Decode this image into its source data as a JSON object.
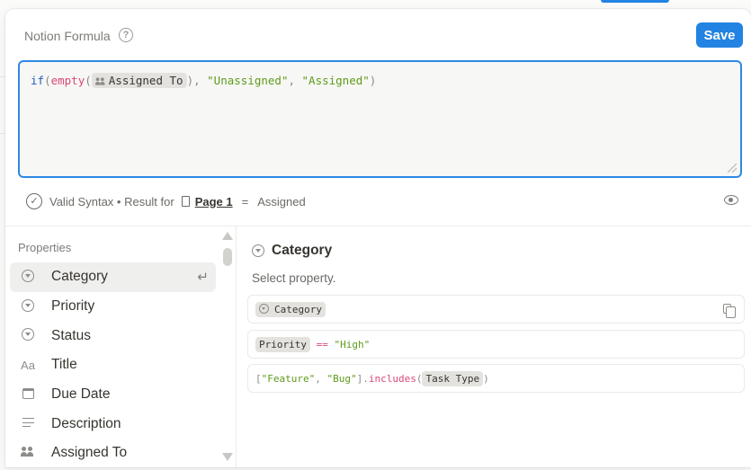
{
  "header": {
    "title": "Notion Formula",
    "help_glyph": "?",
    "save_label": "Save"
  },
  "editor": {
    "keyword_if": "if",
    "open_paren": "(",
    "fn_empty": "empty",
    "fn_open": "(",
    "chip_label": "Assigned To",
    "fn_close": ")",
    "sep": ", ",
    "str_unassigned": "\"Unassigned\"",
    "str_assigned": "\"Assigned\"",
    "close_paren": ")"
  },
  "status": {
    "check_glyph": "✓",
    "text_prefix": "Valid Syntax • Result for",
    "page_name": "Page 1",
    "equals": "=",
    "result_value": "Assigned"
  },
  "properties": {
    "header": "Properties",
    "items": [
      {
        "label": "Category",
        "icon": "select-icon"
      },
      {
        "label": "Priority",
        "icon": "select-icon"
      },
      {
        "label": "Status",
        "icon": "select-icon"
      },
      {
        "label": "Title",
        "icon": "text-aa-icon",
        "glyph": "Aa"
      },
      {
        "label": "Due Date",
        "icon": "calendar-icon"
      },
      {
        "label": "Description",
        "icon": "text-lines-icon"
      },
      {
        "label": "Assigned To",
        "icon": "people-icon"
      }
    ],
    "enter_glyph": "↵"
  },
  "detail": {
    "title": "Category",
    "description": "Select property.",
    "examples": {
      "ex1_chip": "Category",
      "ex2_chip": "Priority",
      "ex2_op": "==",
      "ex2_value": "\"High\"",
      "ex3_list": "[\"Feature\", \"Bug\"]",
      "ex3_dot": ".",
      "ex3_fn": "includes",
      "ex3_open": "(",
      "ex3_chip": "Task Type",
      "ex3_close": ")"
    }
  },
  "colors": {
    "accent": "#2383e2",
    "keyword": "#1f5fbf",
    "function": "#d9487b",
    "string": "#5e9b1a"
  }
}
